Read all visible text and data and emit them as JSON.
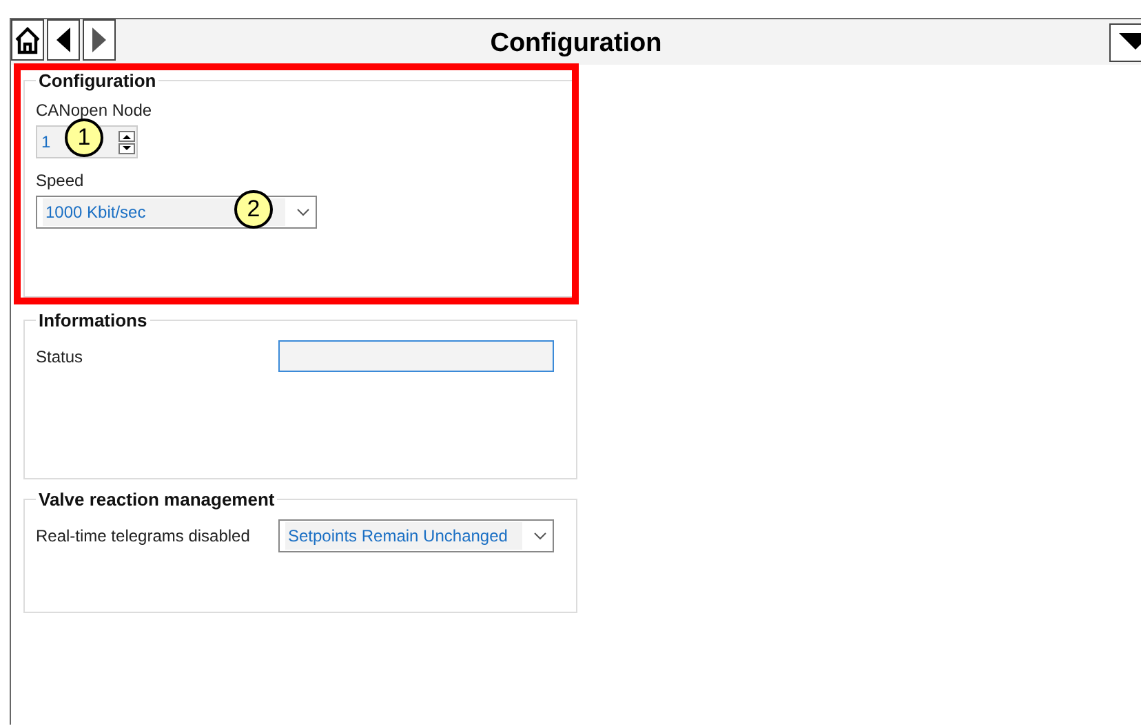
{
  "window": {
    "title": "Configuration"
  },
  "groups": [
    {
      "title": "Configuration",
      "kind": "stacked",
      "fields": [
        {
          "kind": "spinner",
          "label": "CANopen Node",
          "value": "1"
        },
        {
          "kind": "combo",
          "label": "Speed",
          "value": "1000 Kbit/sec"
        }
      ]
    },
    {
      "title": "Informations",
      "kind": "inline",
      "fields": [
        {
          "kind": "text",
          "label": "Status"
        }
      ]
    },
    {
      "title": "Valve reaction management",
      "kind": "inline",
      "fields": [
        {
          "kind": "combo",
          "label": "Real-time telegrams disabled",
          "value": "Setpoints Remain Unchanged"
        }
      ]
    }
  ],
  "callouts": [
    "1",
    "2"
  ]
}
